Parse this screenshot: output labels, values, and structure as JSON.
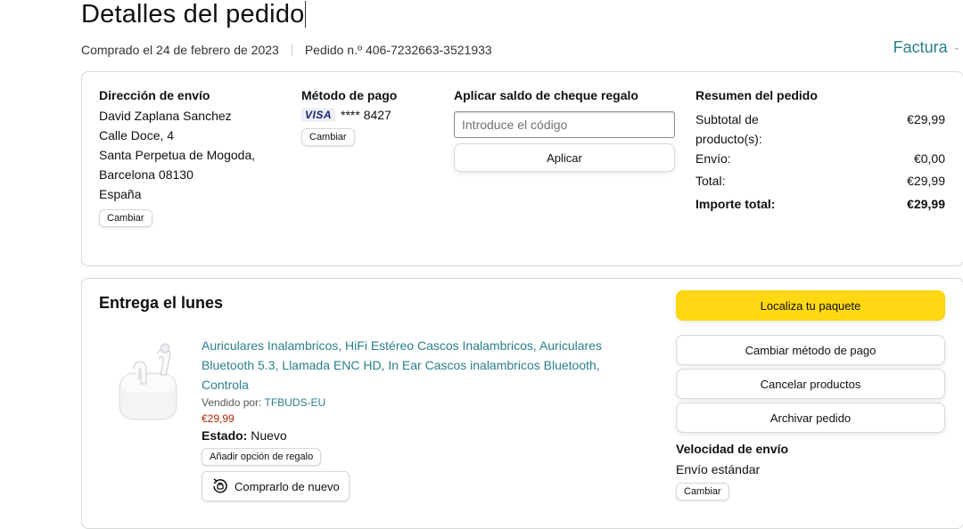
{
  "header": {
    "title": "Detalles del pedido",
    "purchased": "Comprado el 24 de febrero de 2023",
    "order_number": "Pedido n.º 406-7232663-3521933",
    "invoice_label": "Factura"
  },
  "shipping": {
    "heading": "Dirección de envío",
    "lines": [
      "David Zaplana Sanchez",
      "Calle Doce, 4",
      "Santa Perpetua de Mogoda,",
      "Barcelona 08130",
      "España"
    ],
    "change_label": "Cambiar"
  },
  "payment": {
    "heading": "Método de pago",
    "card_brand": "VISA",
    "card_number": "**** 8427",
    "change_label": "Cambiar"
  },
  "gift": {
    "heading": "Aplicar saldo de cheque regalo",
    "placeholder": "Introduce el código",
    "apply_label": "Aplicar"
  },
  "summary": {
    "heading": "Resumen del pedido",
    "subtotal_label_1": "Subtotal de",
    "subtotal_label_2": "producto(s):",
    "subtotal_value": "€29,99",
    "shipping_label": "Envío:",
    "shipping_value": "€0,00",
    "total_label": "Total:",
    "total_value": "€29,99",
    "grand_label": "Importe total:",
    "grand_value": "€29,99"
  },
  "delivery": {
    "heading": "Entrega el lunes",
    "product_title_lines": [
      "Auriculares Inalambricos, HiFi Estéreo Cascos Inalambricos, Auriculares",
      "Bluetooth 5.3, Llamada ENC HD, In Ear Cascos inalambricos Bluetooth,",
      "Controla"
    ],
    "sold_by_label": "Vendido por:",
    "seller": "TFBUDS-EU",
    "price": "€29,99",
    "condition_label": "Estado:",
    "condition_value": "Nuevo",
    "gift_option_label": "Añadir opción de regalo",
    "buy_again_label": "Comprarlo de nuevo"
  },
  "actions": {
    "track": "Localiza tu paquete",
    "change_payment": "Cambiar método de pago",
    "cancel": "Cancelar productos",
    "archive": "Archivar pedido"
  },
  "shipping_speed": {
    "heading": "Velocidad de envío",
    "value": "Envío estándar",
    "change_label": "Cambiar"
  },
  "colors": {
    "link": "#2a7f8b",
    "primary_button": "#ffd814",
    "price": "#b12704"
  }
}
